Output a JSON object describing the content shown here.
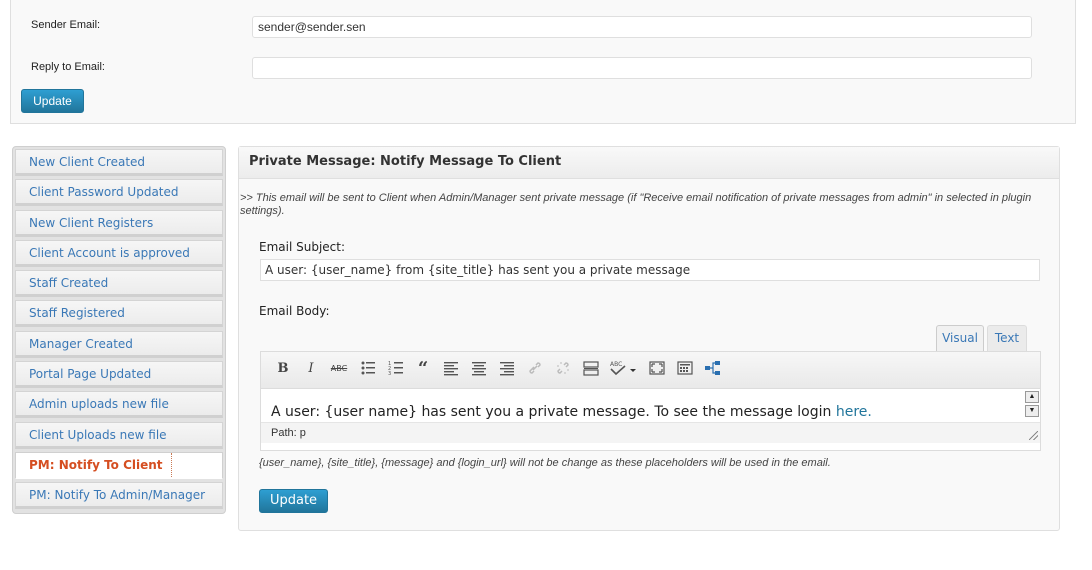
{
  "settings": {
    "sender_email_label": "Sender Email:",
    "sender_email_value": "sender@sender.sen",
    "reply_to_label": "Reply to Email:",
    "reply_to_value": "",
    "update_label": "Update"
  },
  "sidebar": {
    "items": [
      {
        "label": "New Client Created"
      },
      {
        "label": "Client Password Updated"
      },
      {
        "label": "New Client Registers"
      },
      {
        "label": "Client Account is approved"
      },
      {
        "label": "Staff Created"
      },
      {
        "label": "Staff Registered"
      },
      {
        "label": "Manager Created"
      },
      {
        "label": "Portal Page Updated"
      },
      {
        "label": "Admin uploads new file"
      },
      {
        "label": "Client Uploads new file"
      },
      {
        "label": "PM: Notify To Client",
        "active": true
      },
      {
        "label": "PM: Notify To Admin/Manager"
      }
    ]
  },
  "panel": {
    "title": "Private Message: Notify Message To Client",
    "description": ">> This email will be sent to Client when Admin/Manager sent private message (if \"Receive email notification of private messages from admin\" in selected in plugin settings).",
    "subject_label": "Email Subject:",
    "subject_value": "A user: {user_name} from {site_title} has sent you a private message",
    "body_label": "Email Body:",
    "tabs": {
      "visual": "Visual",
      "text": "Text"
    },
    "toolbar_icons": [
      "bold-icon",
      "italic-icon",
      "strikethrough-icon",
      "bullet-list-icon",
      "numbered-list-icon",
      "blockquote-icon",
      "align-left-icon",
      "align-center-icon",
      "align-right-icon",
      "link-icon",
      "unlink-icon",
      "insert-more-icon",
      "spellcheck-icon",
      "fullscreen-icon",
      "toolbar-toggle-icon",
      "placeholder-tree-icon"
    ],
    "body_text": "A user: {user  name} has sent you a private message. To see the message login ",
    "body_link": "here.",
    "path_text": "Path: p",
    "note": "{user_name}, {site_title}, {message} and {login_url} will not be change as these placeholders will be used in the email.",
    "update_label": "Update"
  },
  "colors": {
    "accent": "#21759b",
    "link": "#3a78b6",
    "active": "#d54e21"
  }
}
